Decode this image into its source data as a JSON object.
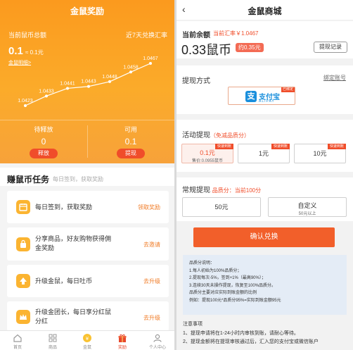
{
  "left": {
    "title": "金鼠奖励",
    "total_label": "当前鼠币总额",
    "rate_label": "近7天兑换汇率",
    "amount": "0.1",
    "amount_sub": "≈ 0.1元",
    "detail_link": "金鼠明细>",
    "pending_label": "待释放",
    "pending_value": "0",
    "release_btn": "释放",
    "available_label": "可用",
    "available_value": "0.1",
    "withdraw_btn": "提现",
    "task_title": "赚鼠币任务",
    "task_subtitle": "每日签到，获取奖励",
    "tasks": [
      {
        "text": "每日签到，获取奖励",
        "action": "领取奖励",
        "icon": "calendar-icon"
      },
      {
        "text": "分享商品，好友购物获得佣金奖励",
        "line1": "分享商品，好友购物获得佣",
        "line2": "金奖励",
        "action": "去邀请",
        "icon": "share-bag-icon"
      },
      {
        "text": "升级金鼠，每日吐币",
        "action": "去升级",
        "icon": "up-arrow-icon"
      },
      {
        "text": "升级金团长，每日享分红鼠分红",
        "line1": "升级金团长，每日享分红鼠",
        "line2": "分红",
        "action": "去升级",
        "icon": "crown-icon"
      }
    ],
    "tabs": [
      {
        "label": "首页",
        "icon": "home-icon"
      },
      {
        "label": "商品",
        "icon": "grid-icon"
      },
      {
        "label": "金鼠",
        "icon": "rat-coin-icon"
      },
      {
        "label": "奖励",
        "icon": "gift-icon",
        "active": true
      },
      {
        "label": "个人中心",
        "icon": "user-icon"
      }
    ]
  },
  "chart_data": {
    "type": "line",
    "title": "",
    "x": [
      "1",
      "2",
      "3",
      "4",
      "5",
      "6",
      "7"
    ],
    "values": [
      1.0423,
      1.0433,
      1.0441,
      1.0443,
      1.0448,
      1.0458,
      1.0467
    ],
    "labels": [
      "1.0423",
      "1.0433",
      "1.0441",
      "1.0443",
      "1.0448",
      "1.0458",
      "1.0467"
    ],
    "ylim": [
      1.04,
      1.05
    ],
    "grid": false,
    "color": "#ffffff"
  },
  "right": {
    "back": "‹",
    "title": "金鼠商城",
    "balance_label": "当前余额",
    "rate": "当前汇率￥1.0467",
    "balance": "0.33鼠币",
    "balance_yuan": "约0.35元",
    "record_btn": "提现记录",
    "method_title": "提现方式",
    "bind_link": "绑定账号",
    "alipay_cn": "支付宝",
    "alipay_en": "ALIPAY",
    "alipay_bound": "已绑定",
    "activity_title": "活动提现",
    "activity_note": "（免减品质分）",
    "activity_opts": [
      {
        "value": "0.1元",
        "sub": "售价:0.0955鼠币",
        "fast": "快速到账",
        "selected": true
      },
      {
        "value": "1元",
        "fast": "快速到账"
      },
      {
        "value": "10元",
        "fast": "快速到账"
      }
    ],
    "regular_title": "常规提现",
    "quality": "品质分：当前100分",
    "regular_opts": [
      {
        "value": "50元"
      },
      {
        "value": "自定义",
        "sub": "50元以上"
      }
    ],
    "confirm": "确认兑换",
    "info_lines": [
      "品质分说明：",
      "1.每人初始为100%品质分；",
      "2.提现每次-5%，签到+1%（最高90%）；",
      "3.连续30天未操作提现，恢复至100%品质分。",
      "品质分主要对应实际到账金额的比例",
      "例如：提现100元*品质分95%=实际到账金额95元"
    ],
    "notes": [
      "注意事项",
      "1、提现申请将在1-24小时内审核到账，请耐心等待。",
      "2、提现金额将在提现审核通过后，汇入您的支付宝或微信账户"
    ]
  }
}
